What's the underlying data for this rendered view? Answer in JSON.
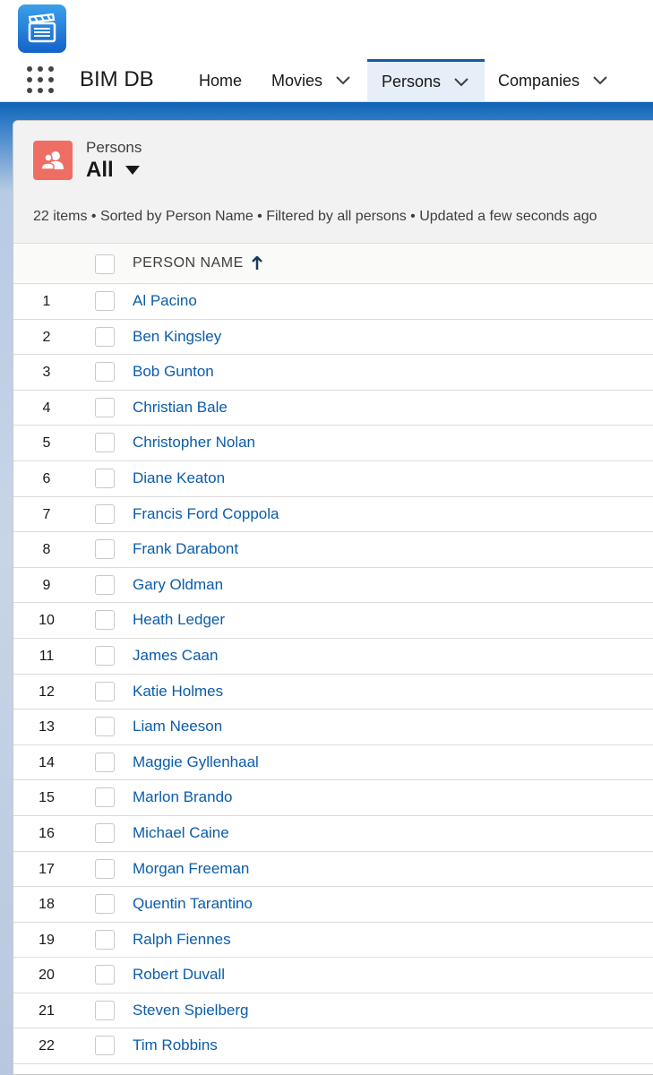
{
  "app": {
    "name": "BIM DB",
    "logo_icon": "clapperboard-icon"
  },
  "nav": {
    "tabs": [
      {
        "label": "Home",
        "has_menu": false,
        "active": false
      },
      {
        "label": "Movies",
        "has_menu": true,
        "active": false
      },
      {
        "label": "Persons",
        "has_menu": true,
        "active": true
      },
      {
        "label": "Companies",
        "has_menu": true,
        "active": false
      }
    ]
  },
  "list_view": {
    "object_label": "Persons",
    "view_name": "All",
    "summary": "22 items • Sorted by Person Name • Filtered by all persons • Updated a few seconds ago",
    "column_header": "PERSON NAME",
    "sort_direction": "ascending"
  },
  "rows": [
    {
      "num": "1",
      "name": "Al Pacino"
    },
    {
      "num": "2",
      "name": "Ben Kingsley"
    },
    {
      "num": "3",
      "name": "Bob Gunton"
    },
    {
      "num": "4",
      "name": "Christian Bale"
    },
    {
      "num": "5",
      "name": "Christopher Nolan"
    },
    {
      "num": "6",
      "name": "Diane Keaton"
    },
    {
      "num": "7",
      "name": "Francis Ford Coppola"
    },
    {
      "num": "8",
      "name": "Frank Darabont"
    },
    {
      "num": "9",
      "name": "Gary Oldman"
    },
    {
      "num": "10",
      "name": "Heath Ledger"
    },
    {
      "num": "11",
      "name": "James Caan"
    },
    {
      "num": "12",
      "name": "Katie Holmes"
    },
    {
      "num": "13",
      "name": "Liam Neeson"
    },
    {
      "num": "14",
      "name": "Maggie Gyllenhaal"
    },
    {
      "num": "15",
      "name": "Marlon Brando"
    },
    {
      "num": "16",
      "name": "Michael Caine"
    },
    {
      "num": "17",
      "name": "Morgan Freeman"
    },
    {
      "num": "18",
      "name": "Quentin Tarantino"
    },
    {
      "num": "19",
      "name": "Ralph Fiennes"
    },
    {
      "num": "20",
      "name": "Robert Duvall"
    },
    {
      "num": "21",
      "name": "Steven Spielberg"
    },
    {
      "num": "22",
      "name": "Tim Robbins"
    }
  ],
  "colors": {
    "link": "#0b5cab",
    "accent": "#0b5cab",
    "object_icon": "#ef6e64"
  }
}
